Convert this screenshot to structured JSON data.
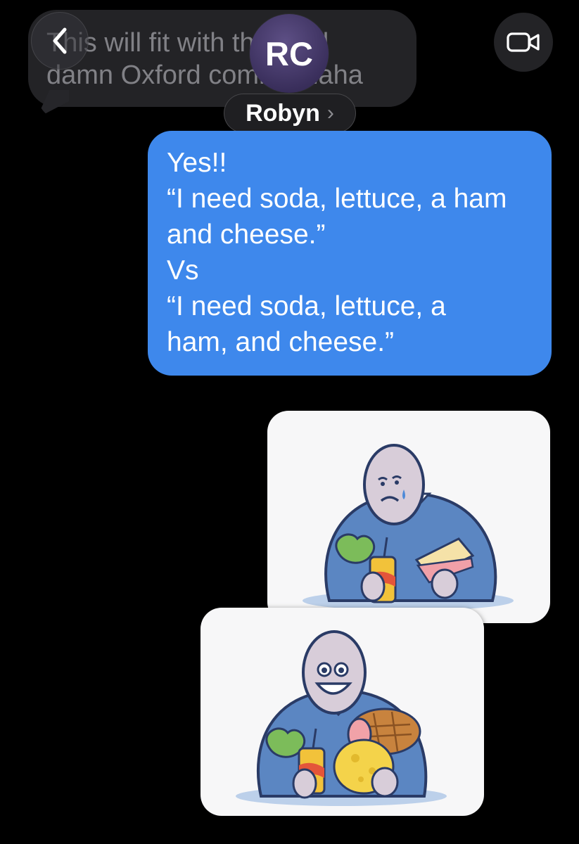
{
  "header": {
    "avatar_initials": "RC",
    "contact_name": "Robyn",
    "name_chevron": "›"
  },
  "messages": {
    "received": {
      "line1": "This will fit with that god",
      "line2": "damn Oxford comma haha"
    },
    "sent": {
      "lines": [
        "Yes!!",
        "“I need soda, lettuce, a ham",
        "and cheese.”",
        "Vs",
        "“I need soda, lettuce, a",
        "ham, and cheese.”"
      ]
    }
  },
  "colors": {
    "background": "#000000",
    "sent_bubble": "#3e88ec",
    "received_bubble": "#26262a",
    "avatar": "#4a3d70",
    "sweater": "#5b86c2",
    "skin": "#d8cdd9"
  },
  "icons": {
    "back": "chevron-left-icon",
    "video": "video-camera-icon"
  },
  "images": [
    {
      "name": "sad-man-with-sandwich-image",
      "mood": "sad"
    },
    {
      "name": "happy-man-with-ham-and-cheese-image",
      "mood": "happy"
    }
  ]
}
